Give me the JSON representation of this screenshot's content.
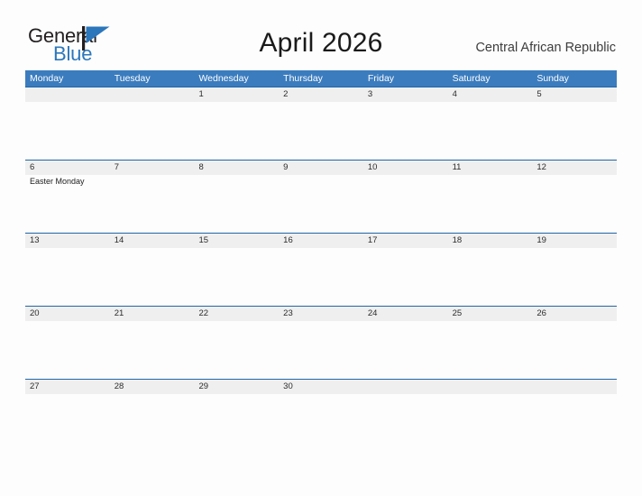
{
  "logo": {
    "text_primary": "General",
    "text_secondary": "Blue",
    "flag_icon": "flag-triangle-icon",
    "primary_color": "#231f20",
    "secondary_color": "#2c76bb"
  },
  "header": {
    "title": "April 2026",
    "country": "Central African Republic"
  },
  "theme": {
    "header_blue": "#3b7cbe",
    "row_rule_blue": "#2166a8",
    "band_gray": "#efefef",
    "page_background": "#fdfdfd"
  },
  "calendar": {
    "weekdays": [
      "Monday",
      "Tuesday",
      "Wednesday",
      "Thursday",
      "Friday",
      "Saturday",
      "Sunday"
    ],
    "weeks": [
      [
        {
          "day": "",
          "event": ""
        },
        {
          "day": "",
          "event": ""
        },
        {
          "day": "1",
          "event": ""
        },
        {
          "day": "2",
          "event": ""
        },
        {
          "day": "3",
          "event": ""
        },
        {
          "day": "4",
          "event": ""
        },
        {
          "day": "5",
          "event": ""
        }
      ],
      [
        {
          "day": "6",
          "event": "Easter Monday"
        },
        {
          "day": "7",
          "event": ""
        },
        {
          "day": "8",
          "event": ""
        },
        {
          "day": "9",
          "event": ""
        },
        {
          "day": "10",
          "event": ""
        },
        {
          "day": "11",
          "event": ""
        },
        {
          "day": "12",
          "event": ""
        }
      ],
      [
        {
          "day": "13",
          "event": ""
        },
        {
          "day": "14",
          "event": ""
        },
        {
          "day": "15",
          "event": ""
        },
        {
          "day": "16",
          "event": ""
        },
        {
          "day": "17",
          "event": ""
        },
        {
          "day": "18",
          "event": ""
        },
        {
          "day": "19",
          "event": ""
        }
      ],
      [
        {
          "day": "20",
          "event": ""
        },
        {
          "day": "21",
          "event": ""
        },
        {
          "day": "22",
          "event": ""
        },
        {
          "day": "23",
          "event": ""
        },
        {
          "day": "24",
          "event": ""
        },
        {
          "day": "25",
          "event": ""
        },
        {
          "day": "26",
          "event": ""
        }
      ],
      [
        {
          "day": "27",
          "event": ""
        },
        {
          "day": "28",
          "event": ""
        },
        {
          "day": "29",
          "event": ""
        },
        {
          "day": "30",
          "event": ""
        },
        {
          "day": "",
          "event": ""
        },
        {
          "day": "",
          "event": ""
        },
        {
          "day": "",
          "event": ""
        }
      ]
    ]
  }
}
